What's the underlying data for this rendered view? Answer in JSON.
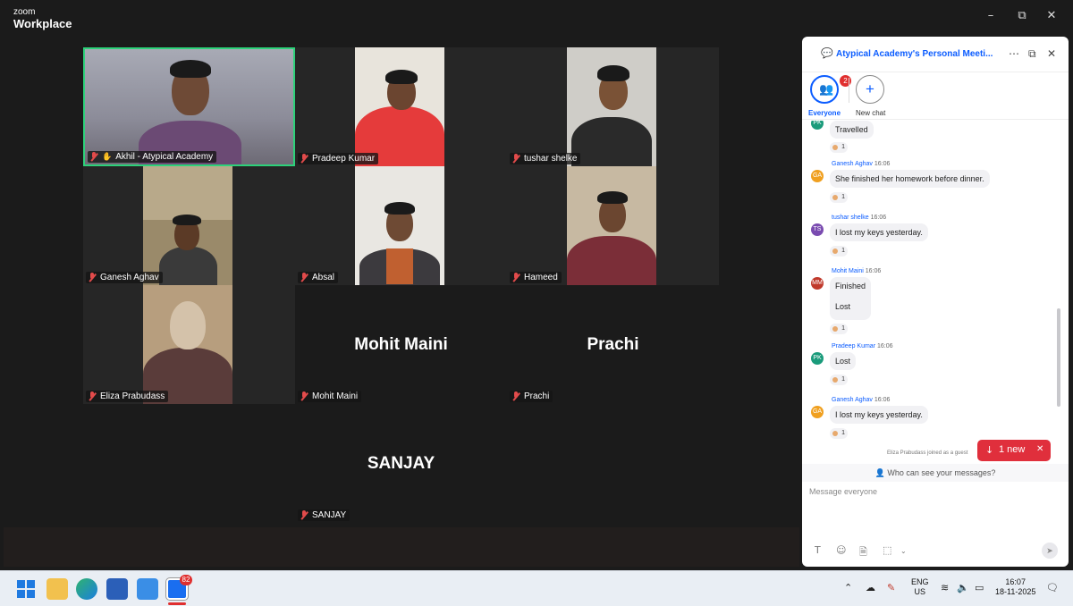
{
  "window": {
    "brand_line1": "zoom",
    "brand_line2": "Workplace",
    "minimize_glyph": "–",
    "maximize_glyph": "⧉",
    "close_glyph": "✕"
  },
  "participants": [
    {
      "name": "Akhil - Atypical Academy",
      "video": true,
      "active_speaker": true
    },
    {
      "name": "Pradeep Kumar",
      "video": true
    },
    {
      "name": "tushar shelke",
      "video": true
    },
    {
      "name": "Ganesh Aghav",
      "video": true
    },
    {
      "name": "Absal",
      "video": true
    },
    {
      "name": "Hameed",
      "video": true
    },
    {
      "name": "Eliza Prabudass",
      "video": true
    },
    {
      "name": "Mohit Maini",
      "video": false
    },
    {
      "name": "Prachi",
      "video": false
    },
    {
      "name": "SANJAY",
      "video": false
    }
  ],
  "chat": {
    "title": "Atypical Academy's Personal Meeti...",
    "tabs": {
      "everyone_label": "Everyone",
      "everyone_badge": "2",
      "new_chat_label": "New chat",
      "new_chat_glyph": "+"
    },
    "messages": [
      {
        "initials": "PK",
        "color": "#1a9b7b",
        "sender": "",
        "time": "",
        "lines": [
          "Travelled"
        ],
        "reaction_count": "1"
      },
      {
        "initials": "GA",
        "color": "#f0a020",
        "sender": "Ganesh Aghav",
        "time": "16:06",
        "lines": [
          "She finished her homework before dinner."
        ],
        "reaction_count": "1"
      },
      {
        "initials": "TS",
        "color": "#7a4bb0",
        "sender": "tushar shelke",
        "time": "16:06",
        "lines": [
          "I lost my keys yesterday."
        ],
        "reaction_count": "1"
      },
      {
        "initials": "MM",
        "color": "#c0392b",
        "sender": "Mohit Maini",
        "time": "16:06",
        "lines": [
          "Finished",
          "Lost"
        ],
        "reaction_count": "1"
      },
      {
        "initials": "PK",
        "color": "#1a9b7b",
        "sender": "Pradeep Kumar",
        "time": "16:06",
        "lines": [
          "Lost"
        ],
        "reaction_count": "1"
      },
      {
        "initials": "GA",
        "color": "#f0a020",
        "sender": "Ganesh Aghav",
        "time": "16:06",
        "lines": [
          "I lost my keys yesterday."
        ],
        "reaction_count": "1"
      }
    ],
    "system_note": "Eliza Prabudass joined as a guest",
    "new_messages_label": "1 new",
    "privacy_link": "Who can see your messages?",
    "input_placeholder": "Message everyone"
  },
  "taskbar": {
    "zoom_badge": "82",
    "lang_line1": "ENG",
    "lang_line2": "US",
    "time": "16:07",
    "date": "18-11-2025"
  }
}
